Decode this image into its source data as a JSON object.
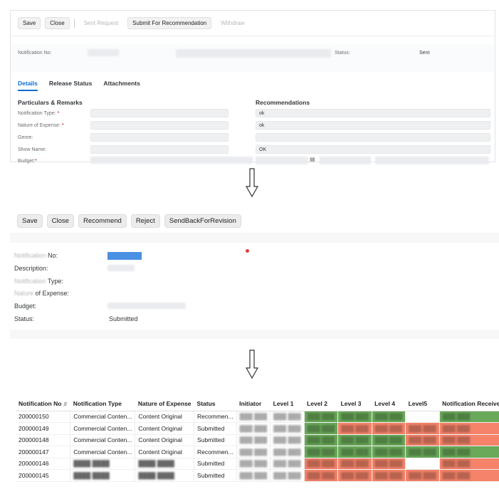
{
  "panel1": {
    "toolbar": [
      "Save",
      "Close",
      "Sent Request",
      "Submit For Recommendation",
      "Withdraw"
    ],
    "disabled": [
      false,
      false,
      true,
      false,
      true
    ],
    "notification_label": "Notification No:",
    "status_label": "Status:",
    "status_value": "Sent",
    "tabs": [
      "Details",
      "Release Status",
      "Attachments"
    ],
    "left_section": "Particulars & Remarks",
    "right_section": "Recommendations",
    "fields": [
      {
        "label": "Notification Type:",
        "required": true
      },
      {
        "label": "Nature of Expense:",
        "required": true
      },
      {
        "label": "Genre:",
        "required": false
      },
      {
        "label": "Show Name:",
        "required": false
      },
      {
        "label": "Budget:",
        "required": true
      }
    ],
    "recommendations": [
      "ok",
      "ok",
      "",
      "OK"
    ]
  },
  "panel2": {
    "toolbar": [
      "Save",
      "Close",
      "Recommend",
      "Reject",
      "SendBackForRevision"
    ],
    "fields": [
      {
        "pre": "Notification",
        "label": "No:"
      },
      {
        "pre": "",
        "label": "Description:"
      },
      {
        "pre": "Notification",
        "label": "Type:"
      },
      {
        "pre": "Nature",
        "label": "of Expense:"
      },
      {
        "pre": "",
        "label": "Budget:"
      },
      {
        "pre": "",
        "label": "Status:"
      }
    ],
    "status_value": "Submitted"
  },
  "table": {
    "headers": [
      "Notification No",
      "Notification Type",
      "Nature of Expense",
      "Status",
      "Initiator",
      "Level 1",
      "Level 2",
      "Level 3",
      "Level 4",
      "Level5",
      "Notification Receiver"
    ],
    "rows": [
      {
        "no": "200000150",
        "type": "Commercial Conten...",
        "nature": "Content Original",
        "status": "Recommen...",
        "levels": [
          "w",
          "g",
          "g",
          "g",
          "w",
          "g"
        ]
      },
      {
        "no": "200000149",
        "type": "Commercial Conten...",
        "nature": "Content Original",
        "status": "Submitted",
        "levels": [
          "w",
          "g",
          "r",
          "r",
          "r",
          "r"
        ]
      },
      {
        "no": "200000148",
        "type": "Commercial Conten...",
        "nature": "Content Original",
        "status": "Submitted",
        "levels": [
          "w",
          "g",
          "g",
          "g",
          "r",
          "r"
        ]
      },
      {
        "no": "200000147",
        "type": "Commercial Conten...",
        "nature": "Content Original",
        "status": "Recommen...",
        "levels": [
          "w",
          "g",
          "g",
          "g",
          "g",
          "g"
        ]
      },
      {
        "no": "200000146",
        "type": "",
        "nature": "",
        "status": "Submitted",
        "levels": [
          "w",
          "r",
          "r",
          "r",
          "w",
          "r"
        ]
      },
      {
        "no": "200000145",
        "type": "",
        "nature": "",
        "status": "Submitted",
        "levels": [
          "w",
          "r",
          "r",
          "r",
          "r",
          "r"
        ]
      }
    ],
    "colors": {
      "g": "#6aa95a",
      "r": "#f4836a",
      "w": "#ffffff"
    }
  }
}
